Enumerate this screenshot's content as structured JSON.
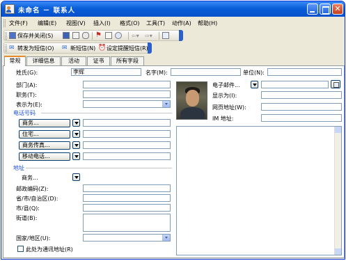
{
  "window": {
    "title": "未命名 － 联系人",
    "icon": "contact-card-icon"
  },
  "menu": {
    "items": [
      "文件(F)",
      "编辑(E)",
      "视图(V)",
      "插入(I)",
      "格式(O)",
      "工具(T)",
      "动作(A)",
      "帮助(H)"
    ]
  },
  "toolbar1": {
    "save_close": "保存并关闭(S)",
    "icons": [
      "save-icon",
      "save-new-icon",
      "attach-icon",
      "flag-icon",
      "new-item-icon",
      "details-icon",
      "previous-icon",
      "next-icon",
      "address-book-icon"
    ]
  },
  "toolbar2": {
    "forward_sms": "转发为短信(O)",
    "new_sms": "新短信(N)",
    "set_reminder_sms": "设定提醒短信(R)"
  },
  "tabs": [
    "常规",
    "详细信息",
    "活动",
    "证书",
    "所有字段"
  ],
  "active_tab": "常规",
  "form": {
    "surname_label": "姓氏(G):",
    "surname_value": "李辉",
    "given_label": "名字(M):",
    "given_value": "",
    "unit_label": "单位(N):",
    "unit_value": "",
    "dept_label": "部门(A):",
    "title_label": "职务(T):",
    "display_label": "表示为(E):",
    "email_label": "电子邮件...",
    "showas_label": "显示为(I):",
    "web_label": "网页地址(W):",
    "im_label": "IM 地址:",
    "phone_section": "电话号码",
    "phones": [
      "商务...",
      "住宅...",
      "商务传真...",
      "移动电话..."
    ],
    "address_section": "地址",
    "address_type": "商务...",
    "zip_label": "邮政编码(Z):",
    "province_label": "省/市/自治区(D):",
    "city_label": "市/县(Q):",
    "street_label": "街道(B):",
    "country_label": "国家/地区(U):",
    "mailing_label": "此处为通讯地址(R)",
    "mailing_checked": false
  }
}
